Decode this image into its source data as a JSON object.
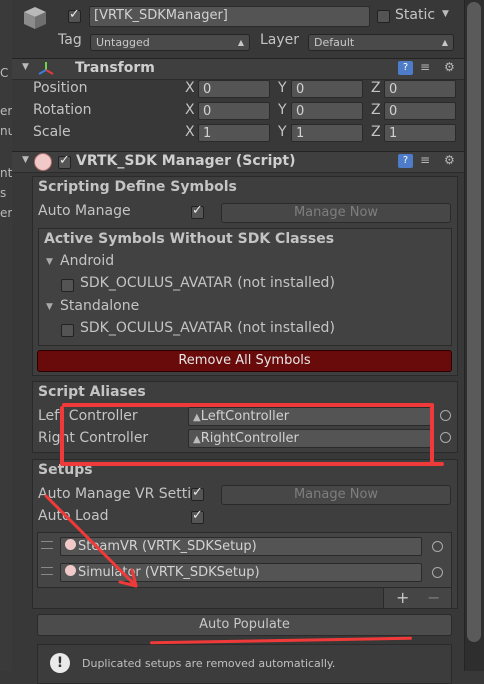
{
  "header": {
    "object_name": "[VRTK_SDKManager]",
    "static_label": "Static",
    "tag_label": "Tag",
    "tag_value": "Untagged",
    "layer_label": "Layer",
    "layer_value": "Default"
  },
  "left_strip": [
    "C",
    "er",
    "nu",
    "nt",
    "s",
    "er"
  ],
  "transform": {
    "title": "Transform",
    "rows": [
      {
        "label": "Position",
        "x": "0",
        "y": "0",
        "z": "0"
      },
      {
        "label": "Rotation",
        "x": "0",
        "y": "0",
        "z": "0"
      },
      {
        "label": "Scale",
        "x": "1",
        "y": "1",
        "z": "1"
      }
    ],
    "axis_x": "X",
    "axis_y": "Y",
    "axis_z": "Z"
  },
  "script": {
    "title": "VRTK_SDK Manager (Script)",
    "define_symbols": {
      "title": "Scripting Define Symbols",
      "auto_manage_label": "Auto Manage",
      "manage_now": "Manage Now",
      "active_title": "Active Symbols Without SDK Classes",
      "groups": [
        {
          "name": "Android",
          "symbol": "SDK_OCULUS_AVATAR (not installed)"
        },
        {
          "name": "Standalone",
          "symbol": "SDK_OCULUS_AVATAR (not installed)"
        }
      ],
      "remove_all": "Remove All Symbols"
    },
    "aliases": {
      "title": "Script Aliases",
      "left_label": "Left Controller",
      "left_value": "LeftController",
      "right_label": "Right Controller",
      "right_value": "RightController"
    },
    "setups": {
      "title": "Setups",
      "auto_manage_label": "Auto Manage VR Settings",
      "manage_now": "Manage Now",
      "auto_load_label": "Auto Load",
      "items": [
        "SteamVR (VRTK_SDKSetup)",
        "Simulator (VRTK_SDKSetup)"
      ],
      "plus": "+",
      "minus": "−",
      "auto_populate": "Auto Populate",
      "info": "Duplicated setups are removed automatically."
    }
  },
  "colors": {
    "remove_button": "#6a0b0b",
    "annotation": "#f03a3a"
  }
}
